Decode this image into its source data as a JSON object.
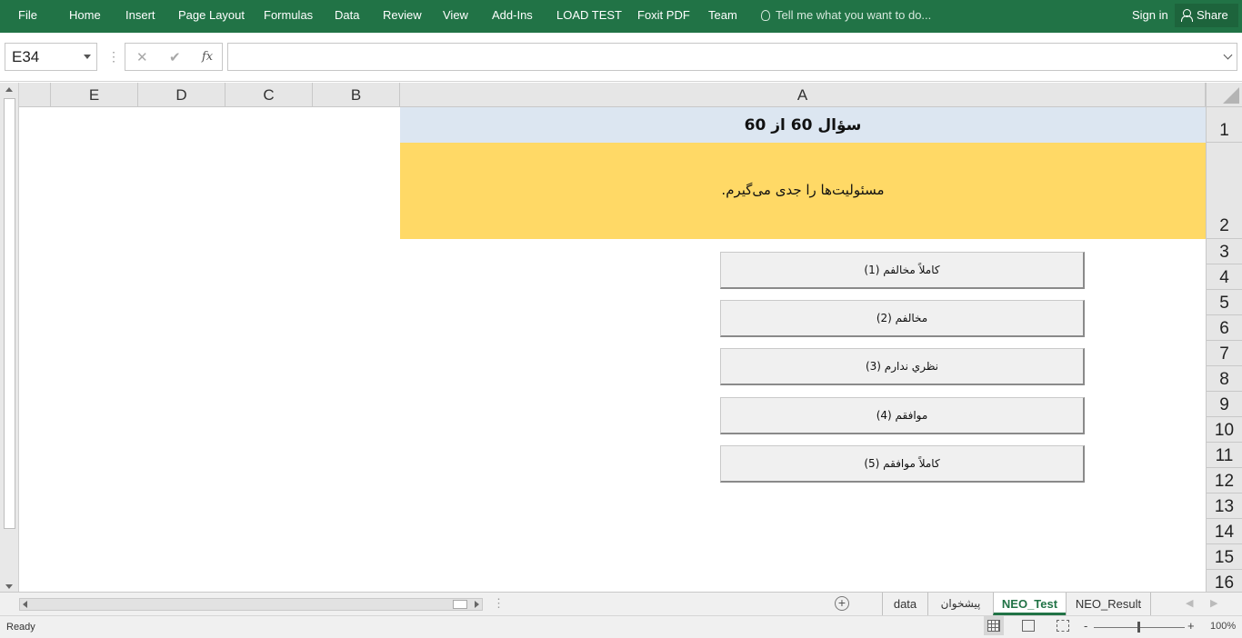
{
  "ribbon": {
    "tabs": [
      "File",
      "Home",
      "Insert",
      "Page Layout",
      "Formulas",
      "Data",
      "Review",
      "View",
      "Add-Ins",
      "LOAD TEST",
      "Foxit PDF",
      "Team"
    ],
    "tell_me": "Tell me what you want to do...",
    "sign_in": "Sign in",
    "share": "Share",
    "colors": {
      "ribbon_bg": "#217346"
    }
  },
  "formula_bar": {
    "name_box": "E34",
    "cancel_icon": "✕",
    "enter_icon": "✔",
    "fx_label": "fx",
    "value": ""
  },
  "columns": [
    "E",
    "D",
    "C",
    "B",
    "A"
  ],
  "rows": [
    "1",
    "2",
    "3",
    "4",
    "5",
    "6",
    "7",
    "8",
    "9",
    "10",
    "11",
    "12",
    "13",
    "14",
    "15",
    "16"
  ],
  "sheet": {
    "title": "سؤال 60 از 60",
    "question": "مسئولیت‌ها را جدی می‌گیرم.",
    "answers": [
      "كاملاً مخالفم (1)",
      "مخالفم (2)",
      "نظري ندارم (3)",
      "موافقم (4)",
      "كاملاً موافقم (5)"
    ],
    "colors": {
      "title_bg": "#dce6f1",
      "question_bg": "#ffd966"
    }
  },
  "sheet_tabs": {
    "tabs": [
      "data",
      "پیشخوان",
      "NEO_Test",
      "NEO_Result"
    ],
    "active": "NEO_Test",
    "add_icon": "+"
  },
  "status": {
    "ready": "Ready",
    "zoom_minus": "-",
    "zoom_plus": "+",
    "zoom": "100%"
  }
}
